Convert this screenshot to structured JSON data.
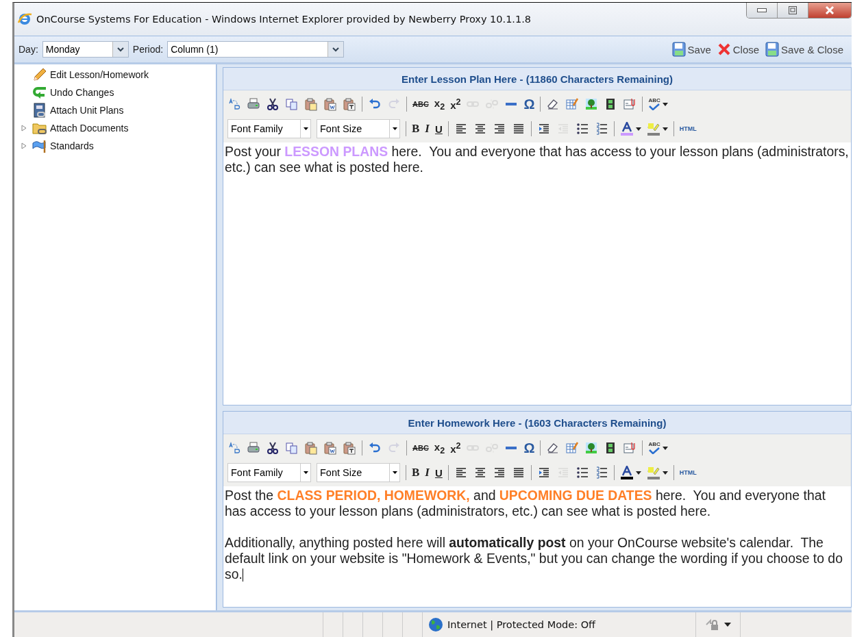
{
  "window": {
    "title": "OnCourse Systems For Education - Windows Internet Explorer provided by Newberry Proxy 10.1.1.8"
  },
  "toolbar": {
    "day_label": "Day:",
    "day": "Monday",
    "period_label": "Period:",
    "period": "Column (1)",
    "actions": [
      {
        "kind": "save",
        "label": "Save"
      },
      {
        "kind": "close",
        "label": "Close"
      },
      {
        "kind": "save-close",
        "label": "Save & Close"
      }
    ]
  },
  "sidebar": {
    "items": [
      {
        "kind": "edit",
        "label": "Edit Lesson/Homework"
      },
      {
        "kind": "undo",
        "label": "Undo Changes"
      },
      {
        "kind": "unit-plans",
        "label": "Attach Unit Plans"
      },
      {
        "kind": "documents",
        "label": "Attach Documents",
        "expanded": false
      },
      {
        "kind": "standards",
        "label": "Standards",
        "expanded": false
      }
    ]
  },
  "editors": [
    {
      "title": "Enter Lesson Plan Here - (11860 Characters Remaining)",
      "toolbar": [
        [
          {
            "kind": "find-replace",
            "disabled": false
          },
          {
            "kind": "print",
            "disabled": false
          },
          {
            "kind": "cut",
            "disabled": false
          },
          {
            "kind": "copy",
            "disabled": false
          },
          {
            "kind": "paste",
            "disabled": false
          },
          {
            "kind": "paste-word",
            "disabled": false
          },
          {
            "kind": "paste-text",
            "disabled": false
          }
        ],
        [
          {
            "kind": "undo",
            "disabled": false
          },
          {
            "kind": "redo",
            "disabled": true
          }
        ],
        [
          {
            "kind": "strike",
            "label": "ABC",
            "disabled": false
          },
          {
            "kind": "subscript",
            "label": "x$_{2}$",
            "disabled": false
          },
          {
            "kind": "superscript",
            "label": "x$^{2}$",
            "disabled": false
          },
          {
            "kind": "link",
            "disabled": true
          },
          {
            "kind": "unlink",
            "disabled": true
          },
          {
            "kind": "rule",
            "disabled": false
          },
          {
            "kind": "symbol",
            "label": "Ω",
            "disabled": false
          }
        ],
        [
          {
            "kind": "eraser",
            "disabled": false
          },
          {
            "kind": "table",
            "disabled": false
          },
          {
            "kind": "image",
            "disabled": false
          },
          {
            "kind": "media",
            "disabled": false
          },
          {
            "kind": "template",
            "disabled": false
          }
        ],
        [
          {
            "kind": "spellcheck",
            "label": "ABC"
          }
        ]
      ],
      "format_bar": [
        [
          {
            "kind": "select",
            "label": "Font Family"
          },
          {
            "kind": "select",
            "label": "Font Size"
          }
        ],
        [
          {
            "kind": "bold",
            "label": "B"
          },
          {
            "kind": "italic",
            "label": "I"
          },
          {
            "kind": "underline",
            "label": "U"
          }
        ],
        [
          {
            "kind": "align-left"
          },
          {
            "kind": "align-center"
          },
          {
            "kind": "align-right"
          },
          {
            "kind": "justify"
          }
        ],
        [
          {
            "kind": "indent",
            "disabled": false
          },
          {
            "kind": "outdent",
            "disabled": true
          },
          {
            "kind": "bullets"
          },
          {
            "kind": "numbers"
          }
        ],
        [
          {
            "kind": "font-color",
            "color": "#cc99ff"
          },
          {
            "kind": "highlight",
            "color": "#808080"
          }
        ],
        [
          {
            "kind": "html",
            "label": "HTML"
          }
        ]
      ],
      "paragraphs": [
        [
          {
            "kind": "plain",
            "text": "Post your "
          },
          {
            "kind": "accent",
            "color": "#cc99ff",
            "text": "LESSON PLANS"
          },
          {
            "kind": "plain",
            "text": " here.  You and everyone that has access to your lesson plans (administrators, etc.) can see what is posted here."
          }
        ]
      ]
    },
    {
      "title": "Enter Homework Here - (1603 Characters Remaining)",
      "toolbar": [
        [
          {
            "kind": "find-replace",
            "disabled": false
          },
          {
            "kind": "print",
            "disabled": false
          },
          {
            "kind": "cut",
            "disabled": false
          },
          {
            "kind": "copy",
            "disabled": false
          },
          {
            "kind": "paste",
            "disabled": false
          },
          {
            "kind": "paste-word",
            "disabled": false
          },
          {
            "kind": "paste-text",
            "disabled": false
          }
        ],
        [
          {
            "kind": "undo",
            "disabled": false
          },
          {
            "kind": "redo",
            "disabled": true
          }
        ],
        [
          {
            "kind": "strike",
            "label": "ABC",
            "disabled": false
          },
          {
            "kind": "subscript",
            "label": "x$_{2}$",
            "disabled": false
          },
          {
            "kind": "superscript",
            "label": "x$^{2}$",
            "disabled": false
          },
          {
            "kind": "link",
            "disabled": true
          },
          {
            "kind": "unlink",
            "disabled": true
          },
          {
            "kind": "rule",
            "disabled": false
          },
          {
            "kind": "symbol",
            "label": "Ω",
            "disabled": false
          }
        ],
        [
          {
            "kind": "eraser",
            "disabled": false
          },
          {
            "kind": "table",
            "disabled": false
          },
          {
            "kind": "image",
            "disabled": false
          },
          {
            "kind": "media",
            "disabled": false
          },
          {
            "kind": "template",
            "disabled": false
          }
        ],
        [
          {
            "kind": "spellcheck",
            "label": "ABC"
          }
        ]
      ],
      "format_bar": [
        [
          {
            "kind": "select",
            "label": "Font Family"
          },
          {
            "kind": "select",
            "label": "Font Size"
          }
        ],
        [
          {
            "kind": "bold",
            "label": "B"
          },
          {
            "kind": "italic",
            "label": "I"
          },
          {
            "kind": "underline",
            "label": "U"
          }
        ],
        [
          {
            "kind": "align-left"
          },
          {
            "kind": "align-center"
          },
          {
            "kind": "align-right"
          },
          {
            "kind": "justify"
          }
        ],
        [
          {
            "kind": "indent",
            "disabled": false
          },
          {
            "kind": "outdent",
            "disabled": true
          },
          {
            "kind": "bullets"
          },
          {
            "kind": "numbers"
          }
        ],
        [
          {
            "kind": "font-color",
            "color": "#000000"
          },
          {
            "kind": "highlight",
            "color": "#808080"
          }
        ],
        [
          {
            "kind": "html",
            "label": "HTML"
          }
        ]
      ],
      "paragraphs": [
        [
          {
            "kind": "plain",
            "text": "Post the "
          },
          {
            "kind": "accent",
            "color": "#ff7f27",
            "text": "CLASS PERIOD, HOMEWORK,"
          },
          {
            "kind": "plain",
            "text": " and "
          },
          {
            "kind": "accent",
            "color": "#ff7f27",
            "text": "UPCOMING DUE DATES"
          },
          {
            "kind": "plain",
            "text": " here.  You and everyone that has access to your lesson plans (administrators, etc.) can see what is posted here."
          }
        ],
        [
          {
            "kind": "plain",
            "text": "Additionally, anything posted here will "
          },
          {
            "kind": "strong",
            "text": "automatically post"
          },
          {
            "kind": "plain",
            "text": " on your OnCourse website's calendar.  The default link on your website is \"Homework & Events,\" but you can change the wording if you choose to do so."
          }
        ]
      ],
      "cursor": true
    }
  ],
  "status_bar": {
    "zone": "Internet | Protected Mode: Off"
  }
}
